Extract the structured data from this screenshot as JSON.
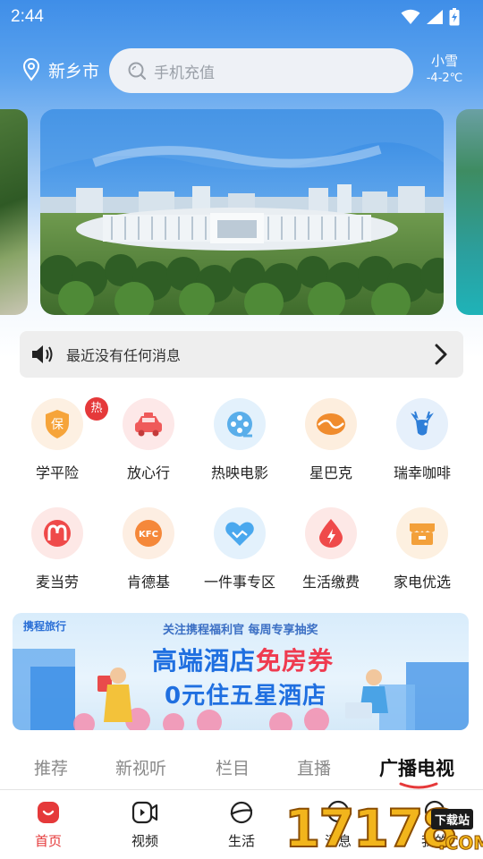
{
  "status_bar": {
    "time": "2:44"
  },
  "header": {
    "location": "新乡市",
    "search_placeholder": "手机充值",
    "weather": {
      "condition": "小雪",
      "temperature": "-4-2℃"
    }
  },
  "notice": {
    "text": "最近没有任何消息"
  },
  "services": {
    "row1": [
      {
        "label": "学平险",
        "icon": "shield-icon",
        "badge": "热",
        "color": "#f6a43a"
      },
      {
        "label": "放心行",
        "icon": "taxi-icon",
        "color": "#ef5a5a"
      },
      {
        "label": "热映电影",
        "icon": "film-reel-icon",
        "color": "#5aaeea"
      },
      {
        "label": "星巴克",
        "icon": "coffee-bean-icon",
        "color": "#f08c2e"
      },
      {
        "label": "瑞幸咖啡",
        "icon": "deer-icon",
        "color": "#2f7fd8"
      }
    ],
    "row2": [
      {
        "label": "麦当劳",
        "icon": "mcdonalds-icon",
        "color": "#ef4a4a"
      },
      {
        "label": "肯德基",
        "icon": "kfc-icon",
        "color": "#f5883a"
      },
      {
        "label": "一件事专区",
        "icon": "handshake-heart-icon",
        "color": "#4aa8ee"
      },
      {
        "label": "生活缴费",
        "icon": "utility-drop-icon",
        "color": "#ef4a4a"
      },
      {
        "label": "家电优选",
        "icon": "appliance-store-icon",
        "color": "#f3a03a"
      }
    ]
  },
  "ad": {
    "brand": "携程旅行",
    "line1": "关注携程福利官 每周专享抽奖",
    "line2_a": "高端酒店",
    "line2_b": "免房券",
    "line3": "0元住五星酒店"
  },
  "tabs": [
    "推荐",
    "新视听",
    "栏目",
    "直播",
    "广播电视"
  ],
  "bottom_nav": [
    {
      "label": "首页",
      "icon": "home-icon",
      "active": true
    },
    {
      "label": "视频",
      "icon": "video-icon",
      "active": false
    },
    {
      "label": "生活",
      "icon": "planet-icon",
      "active": false
    },
    {
      "label": "消息",
      "icon": "message-icon",
      "active": false
    },
    {
      "label": "我的",
      "icon": "profile-icon",
      "active": false
    }
  ],
  "watermark": {
    "digits": "17178",
    "download": "下载站",
    "domain": ".COM"
  },
  "colors": {
    "accent_red": "#e5393a",
    "sky_blue": "#3f8ee8"
  }
}
